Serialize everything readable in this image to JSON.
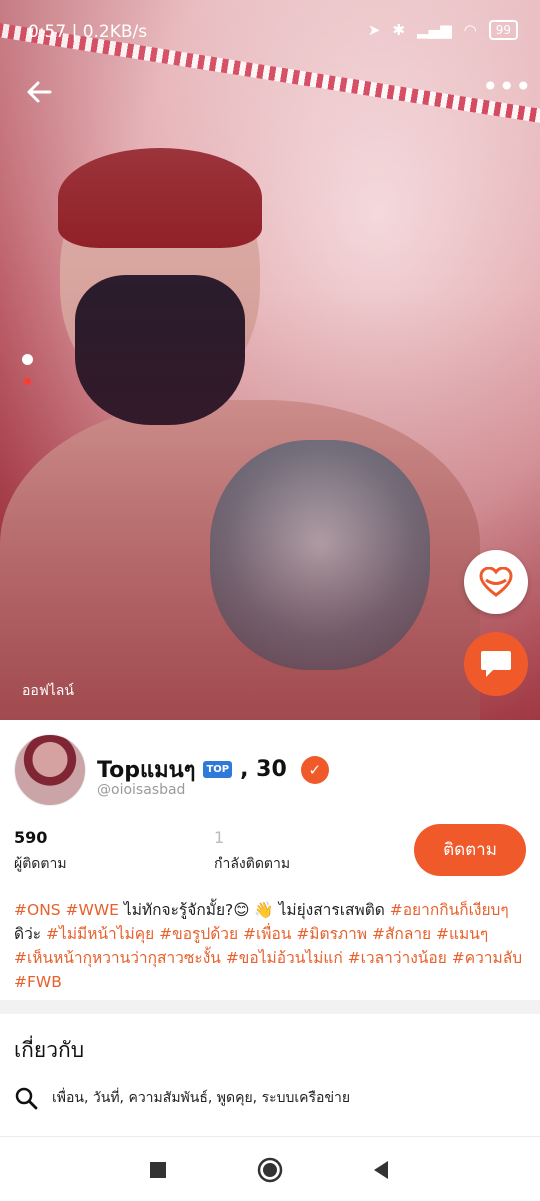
{
  "status_bar": {
    "left_text": "0:57 | 0.2KB/s",
    "battery": "99"
  },
  "photo": {
    "online_label": "ออฟไลน์"
  },
  "profile": {
    "name": "Topแมนๆ",
    "badge": "TOP",
    "age": ", 30",
    "handle": "@oioisasbad",
    "followers_count": "590",
    "followers_label": "ผู้ติดตาม",
    "following_count": "1",
    "following_label": "กำลังติดตาม",
    "follow_button": "ติดตาม"
  },
  "bio": {
    "line1_tags_a": "#ONS #WWE",
    "line1_text": " ไม่ทักจะรู้จักมั้ย?😊 👋 ไม่ยุ่งสารเสพติด ",
    "line1_tag_b": "#อยากกินก็เงียบๆ",
    "line2_text_a": "ดิว่ะ ",
    "line2_tags": "#ไม่มีหน้าไม่คุย #ขอรูปด้วย #เพื่อน #มิตรภาพ #สักลาย #แมนๆ #เห็นหน้ากุหวานว่ากุสาวซะงั้น #ขอไม่อ้วนไม่แก่ #เวลาว่างน้อย #ความลับ #FWB"
  },
  "about": {
    "title": "เกี่ยวกับ",
    "interests": "เพื่อน, วันที่, ความสัมพันธ์, พูดคุย, ระบบเครือข่าย"
  },
  "colors": {
    "accent": "#f05a2b",
    "tag": "#e8602c"
  }
}
